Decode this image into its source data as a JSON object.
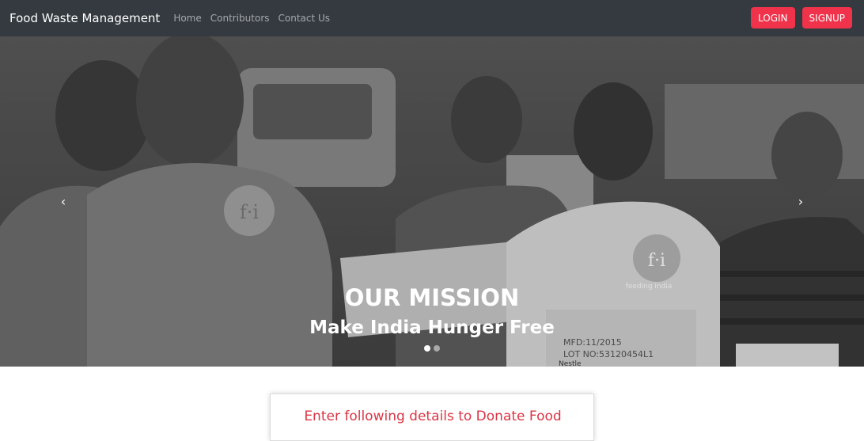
{
  "navbar": {
    "brand": "Food Waste Management",
    "links": [
      "Home",
      "Contributors",
      "Contact Us"
    ],
    "login_label": "LOGIN",
    "signup_label": "SIGNUP",
    "accent_color": "#f0334b"
  },
  "carousel": {
    "caption_title": "OUR MISSION",
    "caption_subtitle": "Make India Hunger Free",
    "prev_icon": "chevron-left-icon",
    "next_icon": "chevron-right-icon",
    "prev_glyph": "‹",
    "next_glyph": "›",
    "slide_count": 2,
    "active_slide": 1,
    "photo_description_icon": "volunteer-photo",
    "photo_texts": {
      "logo": "f·i",
      "logo_caption": "feeding india",
      "box_line1": "MFD:11/2015",
      "box_line2": "LOT NO:53120454L1",
      "box_brand": "Nestle"
    }
  },
  "card": {
    "title": "Enter following details to Donate Food",
    "title_color": "#dc3545"
  }
}
